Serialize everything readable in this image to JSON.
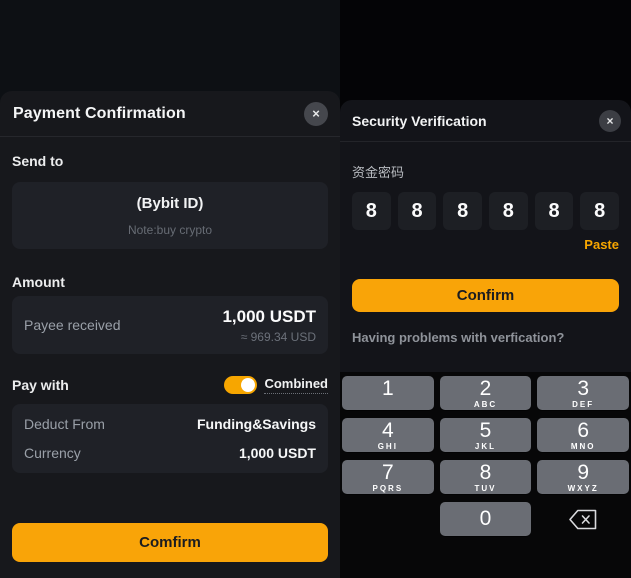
{
  "colors": {
    "accent": "#f7a600",
    "sheet_bg": "#17181c",
    "card_bg": "#1f2127",
    "keypad_key": "#6a6d74"
  },
  "left_screen": {
    "header": {
      "title": "Payment Confirmation",
      "close_icon": "×"
    },
    "send_to": {
      "label": "Send to",
      "recipient": "(Bybit ID)",
      "note": "Note:buy crypto"
    },
    "amount": {
      "label": "Amount",
      "row_label": "Payee received",
      "value": "1,000 USDT",
      "approx": "≈ 969.34 USD"
    },
    "pay_with": {
      "label": "Pay with",
      "toggle_label": "Combined",
      "toggle_on": true,
      "rows": [
        {
          "label": "Deduct From",
          "value": "Funding&Savings"
        },
        {
          "label": "Currency",
          "value": "1,000 USDT"
        }
      ]
    },
    "confirm_label": "Comfirm"
  },
  "right_screen": {
    "header": {
      "title": "Security Verification",
      "close_icon": "×"
    },
    "password": {
      "label": "资金密码",
      "digits": [
        "8",
        "8",
        "8",
        "8",
        "8",
        "8"
      ],
      "paste_label": "Paste"
    },
    "confirm_label": "Confirm",
    "help_text": "Having problems with verfication?",
    "keypad": {
      "keys": [
        {
          "digit": "1",
          "letters": ""
        },
        {
          "digit": "2",
          "letters": "ABC"
        },
        {
          "digit": "3",
          "letters": "DEF"
        },
        {
          "digit": "4",
          "letters": "GHI"
        },
        {
          "digit": "5",
          "letters": "JKL"
        },
        {
          "digit": "6",
          "letters": "MNO"
        },
        {
          "digit": "7",
          "letters": "PQRS"
        },
        {
          "digit": "8",
          "letters": "TUV"
        },
        {
          "digit": "9",
          "letters": "WXYZ"
        }
      ],
      "zero": "0",
      "backspace_icon": "backspace"
    }
  }
}
